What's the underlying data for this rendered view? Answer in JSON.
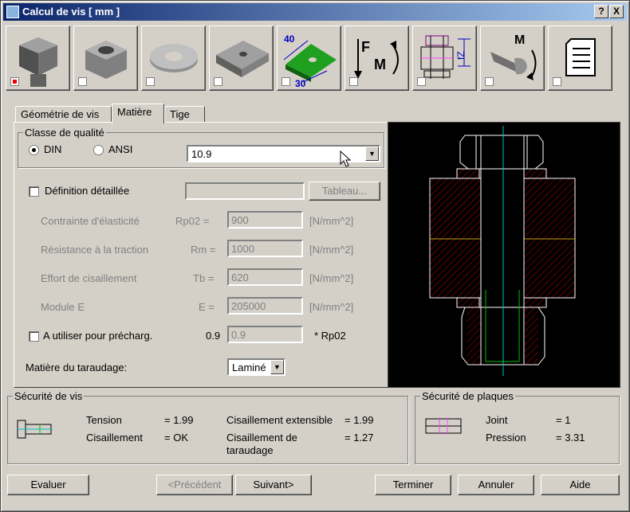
{
  "window": {
    "title": "Calcul de vis [ mm ]",
    "help_button": "?",
    "close_button": "X"
  },
  "toolbar": {
    "tools": [
      {
        "name": "bolt-head",
        "checked": true
      },
      {
        "name": "nut",
        "checked": false
      },
      {
        "name": "washer",
        "checked": false
      },
      {
        "name": "plate",
        "checked": false
      },
      {
        "name": "plate-dimensions",
        "checked": false,
        "label_top": "40",
        "label_bottom": "30"
      },
      {
        "name": "force-moment",
        "checked": false,
        "label_f": "F",
        "label_m": "M"
      },
      {
        "name": "joint-assembly",
        "checked": false,
        "label": "fZ"
      },
      {
        "name": "tightening-torque",
        "checked": false,
        "label": "M"
      },
      {
        "name": "report",
        "checked": false
      }
    ]
  },
  "tabs": [
    {
      "label": "Géométrie de vis",
      "active": false
    },
    {
      "label": "Matière",
      "active": true
    },
    {
      "label": "Tige",
      "active": false
    }
  ],
  "quality": {
    "legend": "Classe de qualité",
    "din_label": "DIN",
    "ansi_label": "ANSI",
    "selected_standard": "DIN",
    "class_value": "10.9"
  },
  "detailed": {
    "label": "Définition détaillée",
    "checked": false,
    "text_value": "",
    "table_button": "Tableau..."
  },
  "properties": [
    {
      "label": "Contrainte d'élasticité",
      "symbol": "Rp02 =",
      "value": "900",
      "unit": "[N/mm^2]"
    },
    {
      "label": "Résistance à la traction",
      "symbol": "Rm =",
      "value": "1000",
      "unit": "[N/mm^2]"
    },
    {
      "label": "Effort de cisaillement",
      "symbol": "Tb =",
      "value": "620",
      "unit": "[N/mm^2]"
    },
    {
      "label": "Module E",
      "symbol": "E =",
      "value": "205000",
      "unit": "[N/mm^2]"
    }
  ],
  "preload": {
    "label": "A utiliser pour précharg.",
    "checked": false,
    "factor": "0.9",
    "field_value": "0.9",
    "suffix": "* Rp02"
  },
  "threading": {
    "label": "Matière du taraudage:",
    "value": "Laminé"
  },
  "bolt_safety": {
    "legend": "Sécurité de vis",
    "tension_label": "Tension",
    "tension_value": "= 1.99",
    "shear_label": "Cisaillement",
    "shear_value": "= OK",
    "ext_shear_label": "Cisaillement extensible",
    "ext_shear_value": "= 1.99",
    "thread_shear_label": "Cisaillement de taraudage",
    "thread_shear_value": "= 1.27"
  },
  "plate_safety": {
    "legend": "Sécurité de plaques",
    "joint_label": "Joint",
    "joint_value": "= 1",
    "pressure_label": "Pression",
    "pressure_value": "= 3.31"
  },
  "buttons": {
    "evaluate": "Evaluer",
    "previous": "<Précédent",
    "next": "Suivant>",
    "finish": "Terminer",
    "cancel": "Annuler",
    "help": "Aide"
  },
  "colors": {
    "titlebar": "#0a246a",
    "preview_bg": "#000000",
    "hatch": "#c00000",
    "axis": "#00c0c0",
    "thread": "#00c000",
    "interface": "#c0a000"
  }
}
